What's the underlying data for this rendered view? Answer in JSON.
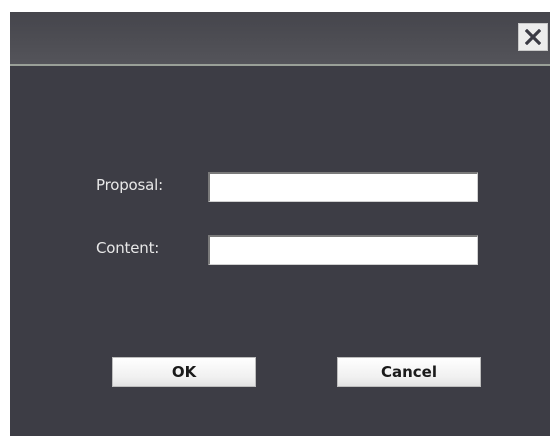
{
  "dialog": {
    "close_icon": "close-icon",
    "fields": [
      {
        "label": "Proposal:",
        "value": "",
        "placeholder": ""
      },
      {
        "label": "Content:",
        "value": "",
        "placeholder": ""
      }
    ],
    "buttons": {
      "ok_label": "OK",
      "cancel_label": "Cancel"
    }
  }
}
